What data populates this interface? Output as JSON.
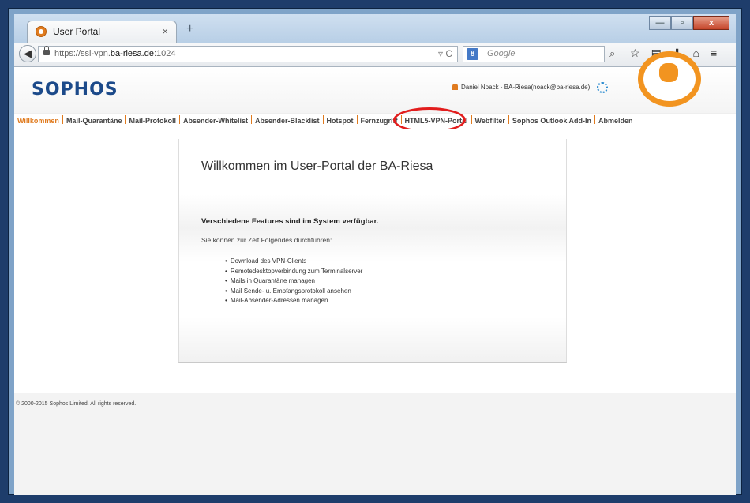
{
  "browser": {
    "tab_title": "User Portal",
    "tab_close": "×",
    "new_tab": "+",
    "url_prefix": "https://ssl-vpn.",
    "url_domain": "ba-riesa.de",
    "url_suffix": ":1024",
    "url_icons": "▿ C",
    "search_engine_badge": "8",
    "search_placeholder": "Google",
    "window_buttons": [
      "—",
      "▫",
      "x"
    ],
    "toolbar_icons": [
      "search-icon",
      "bookmark-star-icon",
      "reading-list-icon",
      "download-icon",
      "home-icon",
      "menu-icon"
    ]
  },
  "header": {
    "logo": "SOPHOS",
    "user": "Daniel Noack - BA-Riesa(noack@ba-riesa.de)"
  },
  "menu": {
    "items": [
      {
        "label": "Willkommen",
        "active": true
      },
      {
        "label": "Mail-Quarantäne"
      },
      {
        "label": "Mail-Protokoll"
      },
      {
        "label": "Absender-Whitelist"
      },
      {
        "label": "Absender-Blacklist"
      },
      {
        "label": "Hotspot"
      },
      {
        "label": "Fernzugriff",
        "highlighted": true
      },
      {
        "label": "HTML5-VPN-Portal"
      },
      {
        "label": "Webfilter"
      },
      {
        "label": "Sophos Outlook Add-In"
      },
      {
        "label": "Abmelden"
      }
    ]
  },
  "content": {
    "title": "Willkommen im User-Portal der BA-Riesa",
    "subtitle": "Verschiedene Features sind im System verfügbar.",
    "description": "Sie können zur Zeit Folgendes durchführen:",
    "features": [
      "Download des VPN-Clients",
      "Remotedesktopverbindung zum Terminalserver",
      "Mails in Quarantäne managen",
      "Mail Sende- u. Empfangsprotokoll ansehen",
      "Mail-Absender-Adressen managen"
    ]
  },
  "footer": {
    "copyright": "© 2000-2015 Sophos Limited. All rights reserved."
  },
  "colors": {
    "accent": "#e07b1f",
    "brand": "#1c4a8a",
    "highlight": "#e21d1d"
  }
}
